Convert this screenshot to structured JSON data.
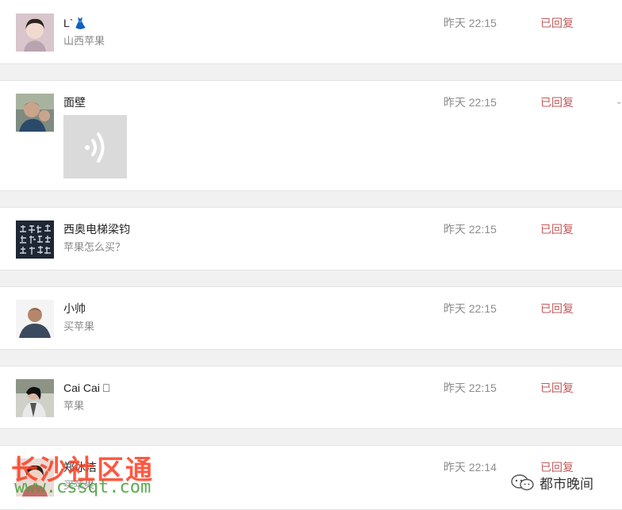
{
  "messages": [
    {
      "name": "L`👗",
      "text": "山西苹果",
      "time": "昨天 22:15",
      "status": "已回复",
      "avatar": "female-portrait"
    },
    {
      "name": "面壁",
      "text": "",
      "time": "昨天 22:15",
      "status": "已回复",
      "avatar": "male-portrait",
      "attachment": "voice-message-icon"
    },
    {
      "name": "西奥电梯梁钧",
      "text": "苹果怎么买？",
      "time": "昨天 22:15",
      "status": "已回复",
      "avatar": "calligraphy-image"
    },
    {
      "name": "小帅",
      "text": "买苹果",
      "time": "昨天 22:15",
      "status": "已回复",
      "avatar": "male-portrait"
    },
    {
      "name": "Cai Cai ⎕",
      "text": "苹果",
      "time": "昨天 22:15",
      "status": "已回复",
      "avatar": "male-portrait"
    },
    {
      "name": "郑冰洁",
      "text": "买苹果",
      "time": "昨天 22:14",
      "status": "已回复",
      "avatar": "female-portrait"
    }
  ],
  "watermarks": {
    "site_name": "长沙社区通",
    "site_url": "www.cssqt.com",
    "brand": "都市晚间"
  },
  "colors": {
    "status": "#c25a5a",
    "background": "#f1f1f1",
    "card": "#ffffff"
  }
}
